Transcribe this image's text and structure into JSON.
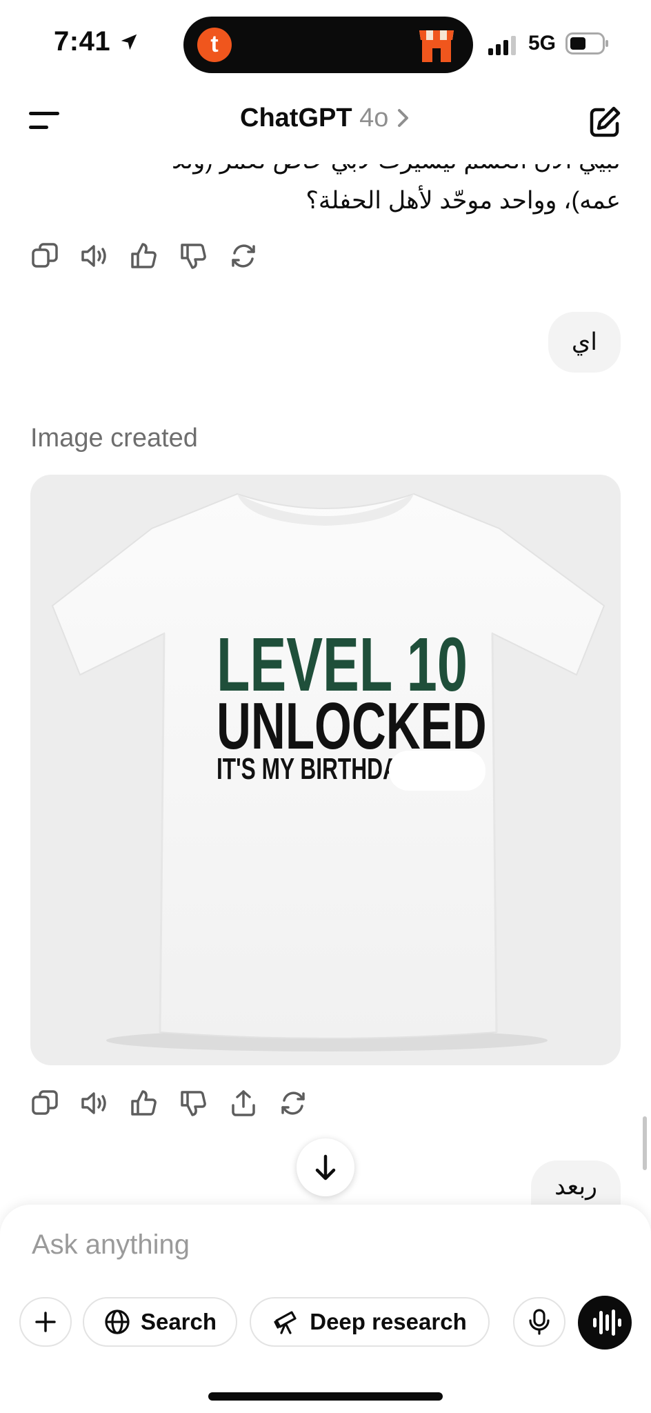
{
  "status_bar": {
    "time": "7:41",
    "network": "5G",
    "island_app_letter": "t"
  },
  "header": {
    "title": "ChatGPT",
    "model": "4o"
  },
  "conversation": {
    "assistant_text_line1": "لبيي الآن العسم تيسيرت لأبي حاص لعمر (وللا",
    "assistant_text_line2": "عمه)، وواحد موحّد لأهل الحفلة؟",
    "user_message_1": "اي",
    "image_created_label": "Image created",
    "shirt": {
      "line1": "LEVEL 10",
      "line2": "UNLOCKED",
      "line3": "IT'S MY BIRTHDAY T"
    },
    "user_message_2": "ربعد"
  },
  "composer": {
    "placeholder": "Ask anything",
    "search_label": "Search",
    "deep_research_label": "Deep research"
  },
  "colors": {
    "shirt_green": "#1f4f3a",
    "island_orange": "#f0561d"
  },
  "icons": [
    "location-arrow-icon",
    "signal-icon",
    "battery-icon",
    "menu-icon",
    "chevron-right-icon",
    "edit-icon",
    "copy-icon",
    "speaker-icon",
    "thumbs-up-icon",
    "thumbs-down-icon",
    "regenerate-icon",
    "share-icon",
    "arrow-down-icon",
    "plus-icon",
    "globe-icon",
    "telescope-icon",
    "mic-icon",
    "voice-wave-icon"
  ]
}
